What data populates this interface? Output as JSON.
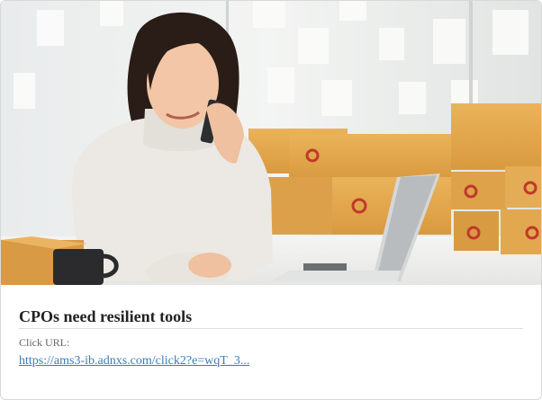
{
  "card": {
    "image_alt": "Woman on phone with laptop and cardboard boxes",
    "title": "CPOs need resilient tools",
    "click_url_label": "Click URL:",
    "click_url": "https://ams3-ib.adnxs.com/click2?e=wqT_3..."
  },
  "colors": {
    "link": "#3a7bbf",
    "box": "#e2a64c",
    "sweater": "#ece9e4"
  }
}
